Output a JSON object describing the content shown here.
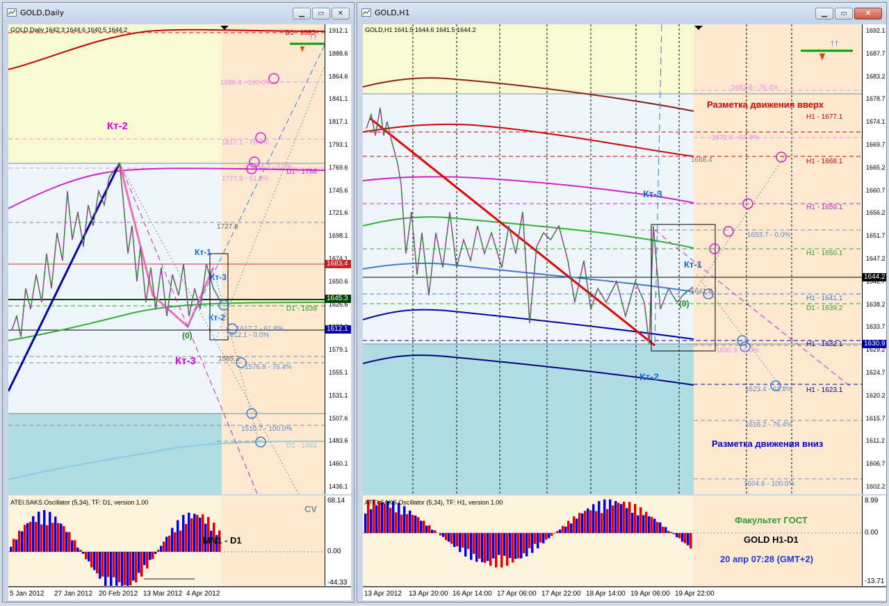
{
  "left_window": {
    "title": "GOLD,Daily",
    "info": "GOLD,Daily  1642.3 1644.6 1640.5 1644.2",
    "price_ticks": [
      "1912.1",
      "1888.6",
      "1864.6",
      "1841.1",
      "1817.1",
      "1793.1",
      "1769.6",
      "1745.6",
      "1721.6",
      "1698.1",
      "1674.1",
      "1650.6",
      "1626.6",
      "1602.6",
      "1579.1",
      "1555.1",
      "1531.1",
      "1507.6",
      "1483.6",
      "1460.1",
      "1436.1"
    ],
    "price_tags": {
      "p1683": "1683.4",
      "p1645": "1645.3",
      "p1612": "1612.1"
    },
    "date_ticks": [
      "5 Jan 2012",
      "27 Jan 2012",
      "20 Feb 2012",
      "13 Mar 2012",
      "4 Apr 2012"
    ],
    "levels": {
      "d1_1932": "D1 - 1932",
      "d1_1786": "D1 - 1786",
      "d1_1639": "D1 - 1639",
      "d1_1492": "D1 - 1492",
      "fib_1880": "1880.4 - 100.0%",
      "fib_1817": "1817.1 - 76.4%",
      "fib_1784": "1784.3 - 0.0%",
      "fib_1777": "1777.9 - 61.8%",
      "lvl_1727": "1727.6",
      "fib_1617": "1617.7 - 61.8%",
      "fib_1612": "1612.1 - 0.0%",
      "lvl_1585": "1585.2",
      "fib_1576": "1576.8 - 76.4%",
      "fib_1510": "1510.7 - 100.0%"
    },
    "marks": {
      "kt2": "Кт-2",
      "kt3": "Кт-3",
      "kt1_small": "Кт-1",
      "kt3_small": "Кт-3",
      "kt2_small": "Кт-2",
      "zero": "(0)"
    },
    "osc": {
      "title": "ATEI.SAKS.Oscillator (5,34), TF: D1,  version 1.00",
      "label": "MN1 - D1",
      "cv": "CV",
      "ticks": [
        "68.14",
        "0.00",
        "-44.33"
      ]
    }
  },
  "right_window": {
    "title": "GOLD,H1",
    "info": "GOLD,H1  1641.5 1644.6 1641.5 1644.2",
    "price_ticks": [
      "1692.1",
      "1687.7",
      "1683.2",
      "1678.7",
      "1674.1",
      "1669.7",
      "1665.2",
      "1660.7",
      "1656.2",
      "1651.7",
      "1647.2",
      "1642.7",
      "1638.2",
      "1633.7",
      "1629.2",
      "1624.7",
      "1620.2",
      "1615.7",
      "1611.2",
      "1606.7",
      "1602.2"
    ],
    "price_tags": {
      "p1644": "1644.2",
      "p1630": "1630.9"
    },
    "date_ticks": [
      "13 Apr 2012",
      "13 Apr 20:00",
      "16 Apr 14:00",
      "17 Apr 06:00",
      "17 Apr 22:00",
      "18 Apr 14:00",
      "19 Apr 06:00",
      "19 Apr 22:00"
    ],
    "levels": {
      "fib_1682": "1682.8 - 76.4%",
      "up_title": "Разметка движения вверх",
      "h1_1677": "H1 - 1677.1",
      "fib_1672": "1672.9 - 61.8%",
      "lvl_1668": "1668.4",
      "h1_1668": "H1 - 1668.1",
      "h1_1659": "H1 - 1659.1",
      "fib_1653": "1653.7 - 0.0%",
      "h1_1650": "H1 - 1650.1",
      "lvl_1641": "1641.8",
      "h1_1641": "H1 - 1641.1",
      "d1_1639": "D1 - 1639.2",
      "h1_1632": "H1 - 1632.1",
      "fib_1630": "1630.9 - 0.0%",
      "fib_1623": "1623.4 - 61.8%",
      "h1_1623": "H1 - 1623.1",
      "fib_1616": "1616.2 - 76.4%",
      "down_title": "Разметка движения вниз",
      "fib_1604": "1604.6 - 100.0%"
    },
    "marks": {
      "kt3": "Кт-3",
      "kt2": "Кт-2",
      "kt1": "Кт-1",
      "zero": "(0)"
    },
    "osc": {
      "title": "ATEI.SAKS.Oscillator (5,34), TF: H1,  version 1.00",
      "faculty": "Факультет ГОСТ",
      "pair": "GOLD    H1-D1",
      "date": "20 апр 07:28  (GMT+2)",
      "ticks": [
        "8.99",
        "0.00",
        "-13.71"
      ]
    }
  },
  "colors": {
    "chart_bg": "#ffffff",
    "zone_yellow": "#fafad2",
    "zone_blue": "#eef5fb",
    "zone_teal": "#b0dde3",
    "zone_orange": "#fde9cf",
    "up_red": "#e00000",
    "down_blue": "#0000cc",
    "green": "#008000",
    "magenta": "#e000e0"
  }
}
